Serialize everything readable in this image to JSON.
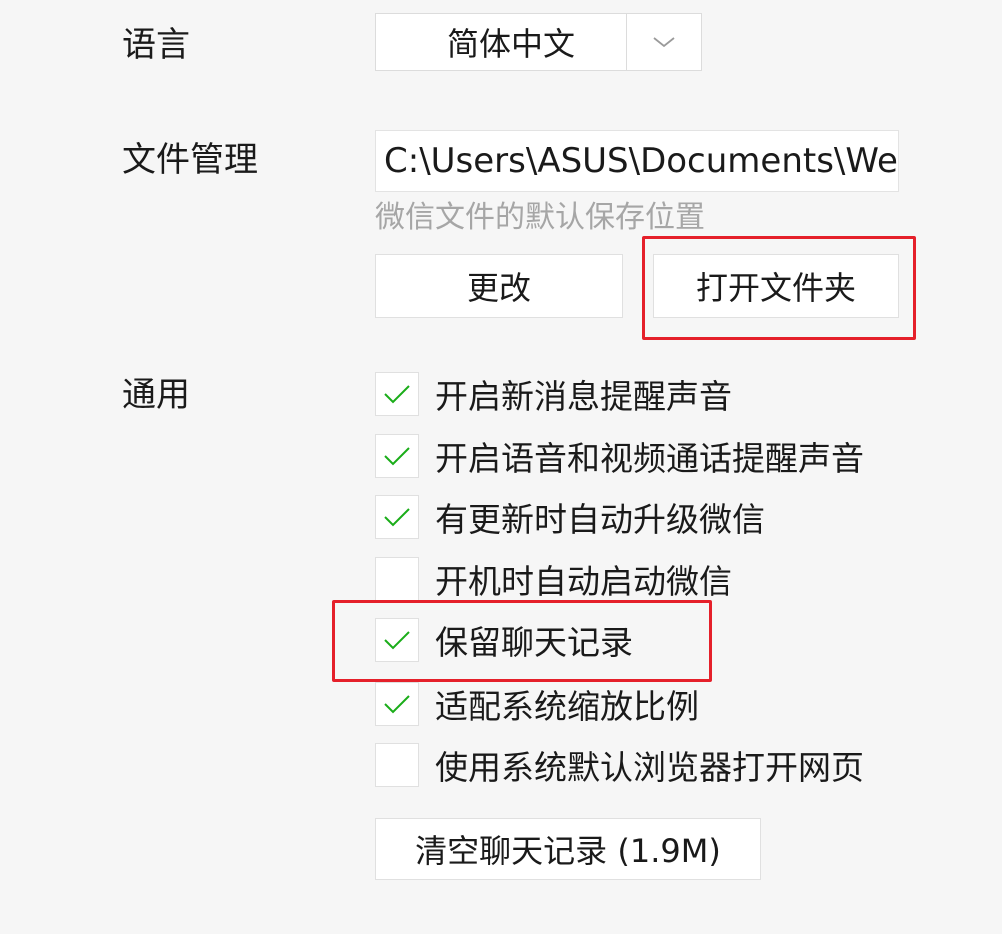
{
  "language": {
    "label": "语言",
    "selected": "简体中文"
  },
  "file_management": {
    "label": "文件管理",
    "path": "C:\\Users\\ASUS\\Documents\\WeChat Files",
    "hint": "微信文件的默认保存位置",
    "change_button": "更改",
    "open_folder_button": "打开文件夹"
  },
  "general": {
    "label": "通用",
    "options": [
      {
        "label": "开启新消息提醒声音",
        "checked": true
      },
      {
        "label": "开启语音和视频通话提醒声音",
        "checked": true
      },
      {
        "label": "有更新时自动升级微信",
        "checked": true
      },
      {
        "label": "开机时自动启动微信",
        "checked": false
      },
      {
        "label": "保留聊天记录",
        "checked": true
      },
      {
        "label": "适配系统缩放比例",
        "checked": true
      },
      {
        "label": "使用系统默认浏览器打开网页",
        "checked": false
      }
    ],
    "clear_button": "清空聊天记录 (1.9M)"
  },
  "colors": {
    "check": "#1aad19",
    "highlight": "#e5202a",
    "hint_text": "#a6a6a6"
  },
  "icons": {
    "dropdown": "chevron-down-icon",
    "check": "check-icon"
  }
}
